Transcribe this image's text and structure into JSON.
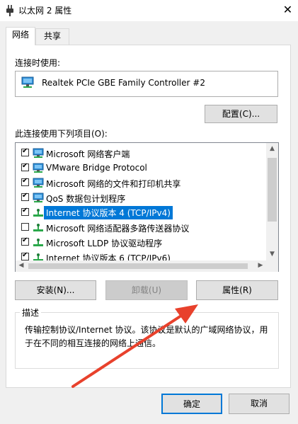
{
  "window": {
    "title": "以太网 2 属性",
    "close_glyph": "✕"
  },
  "tabs": [
    {
      "label": "网络",
      "active": true
    },
    {
      "label": "共享",
      "active": false
    }
  ],
  "connect_using": {
    "label": "连接时使用:",
    "adapter": "Realtek PCIe GBE Family Controller #2",
    "configure_button": "配置(C)..."
  },
  "items_section": {
    "label": "此连接使用下列项目(O):",
    "items": [
      {
        "label": "Microsoft 网络客户端",
        "checked": true,
        "icon": "network-client-icon"
      },
      {
        "label": "VMware Bridge Protocol",
        "checked": true,
        "icon": "network-client-icon"
      },
      {
        "label": "Microsoft 网络的文件和打印机共享",
        "checked": true,
        "icon": "network-client-icon"
      },
      {
        "label": "QoS 数据包计划程序",
        "checked": true,
        "icon": "network-client-icon"
      },
      {
        "label": "Internet 协议版本 4 (TCP/IPv4)",
        "checked": true,
        "icon": "protocol-icon",
        "selected": true
      },
      {
        "label": "Microsoft 网络适配器多路传送器协议",
        "checked": false,
        "icon": "protocol-icon"
      },
      {
        "label": "Microsoft LLDP 协议驱动程序",
        "checked": true,
        "icon": "protocol-icon"
      },
      {
        "label": "Internet 协议版本 6 (TCP/IPv6)",
        "checked": true,
        "icon": "protocol-icon"
      }
    ]
  },
  "actions": {
    "install": "安装(N)...",
    "uninstall": "卸载(U)",
    "properties": "属性(R)"
  },
  "description": {
    "title": "描述",
    "text": "传输控制协议/Internet 协议。该协议是默认的广域网络协议，用于在不同的相互连接的网络上通信。"
  },
  "footer": {
    "ok": "确定",
    "cancel": "取消"
  },
  "colors": {
    "accent": "#0078d7",
    "annotation_arrow": "#e8412c"
  }
}
